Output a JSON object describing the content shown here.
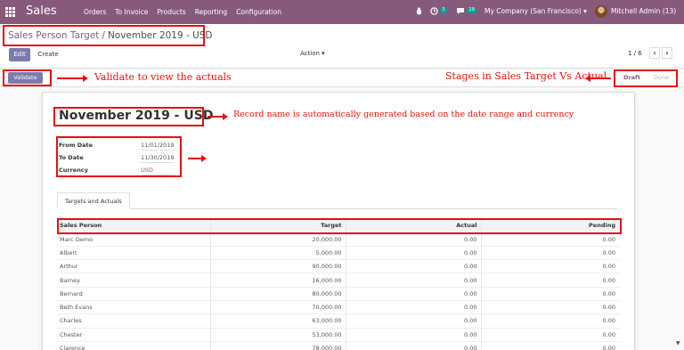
{
  "navbar": {
    "app_name": "Sales",
    "menu": [
      "Orders",
      "To Invoice",
      "Products",
      "Reporting",
      "Configuration"
    ],
    "activity_badge": "3",
    "message_badge": "29",
    "company": "My Company (San Francisco)",
    "user": "Mitchell Admin (13)",
    "icons": [
      "apps-grid-icon",
      "bug-icon",
      "clock-icon",
      "chat-icon",
      "caret-down-icon"
    ]
  },
  "breadcrumb": {
    "parent": "Sales Person Target",
    "separator": "/",
    "current": "November 2019 - USD"
  },
  "toolbar": {
    "edit": "Edit",
    "create": "Create",
    "action": "Action",
    "pager": "1 / 6",
    "prev": "‹",
    "next": "›"
  },
  "statusbar": {
    "validate": "Validate",
    "stages": [
      "Draft",
      "Done"
    ],
    "active_stage": "Draft"
  },
  "annotations": {
    "validate_note": "Validate to view the actuals",
    "stages_note": "Stages in Sales Target Vs Actual",
    "record_note": "Record name is automatically generated based on the date range and currency"
  },
  "record": {
    "title": "November 2019 - USD",
    "fields": [
      {
        "label": "From Date",
        "value": "11/01/2019"
      },
      {
        "label": "To Date",
        "value": "11/30/2019"
      },
      {
        "label": "Currency",
        "value": "USD"
      }
    ]
  },
  "tabs": [
    "Targets and Actuals"
  ],
  "table": {
    "headers": [
      "Sales Person",
      "Target",
      "Actual",
      "Pending"
    ],
    "rows": [
      [
        "Marc Demo",
        "20,000.00",
        "0.00",
        "0.00"
      ],
      [
        "Albert",
        "5,000.00",
        "0.00",
        "0.00"
      ],
      [
        "Arthur",
        "90,000.00",
        "0.00",
        "0.00"
      ],
      [
        "Barney",
        "16,000.00",
        "0.00",
        "0.00"
      ],
      [
        "Bernard",
        "80,000.00",
        "0.00",
        "0.00"
      ],
      [
        "Beth Evans",
        "70,000.00",
        "0.00",
        "0.00"
      ],
      [
        "Charles",
        "63,000.00",
        "0.00",
        "0.00"
      ],
      [
        "Chester",
        "53,000.00",
        "0.00",
        "0.00"
      ],
      [
        "Clarence",
        "78,000.00",
        "0.00",
        "0.00"
      ]
    ]
  },
  "colors": {
    "brand": "#875a7b",
    "primary_button": "#7c7bad",
    "annotation_red": "#e4100d"
  }
}
